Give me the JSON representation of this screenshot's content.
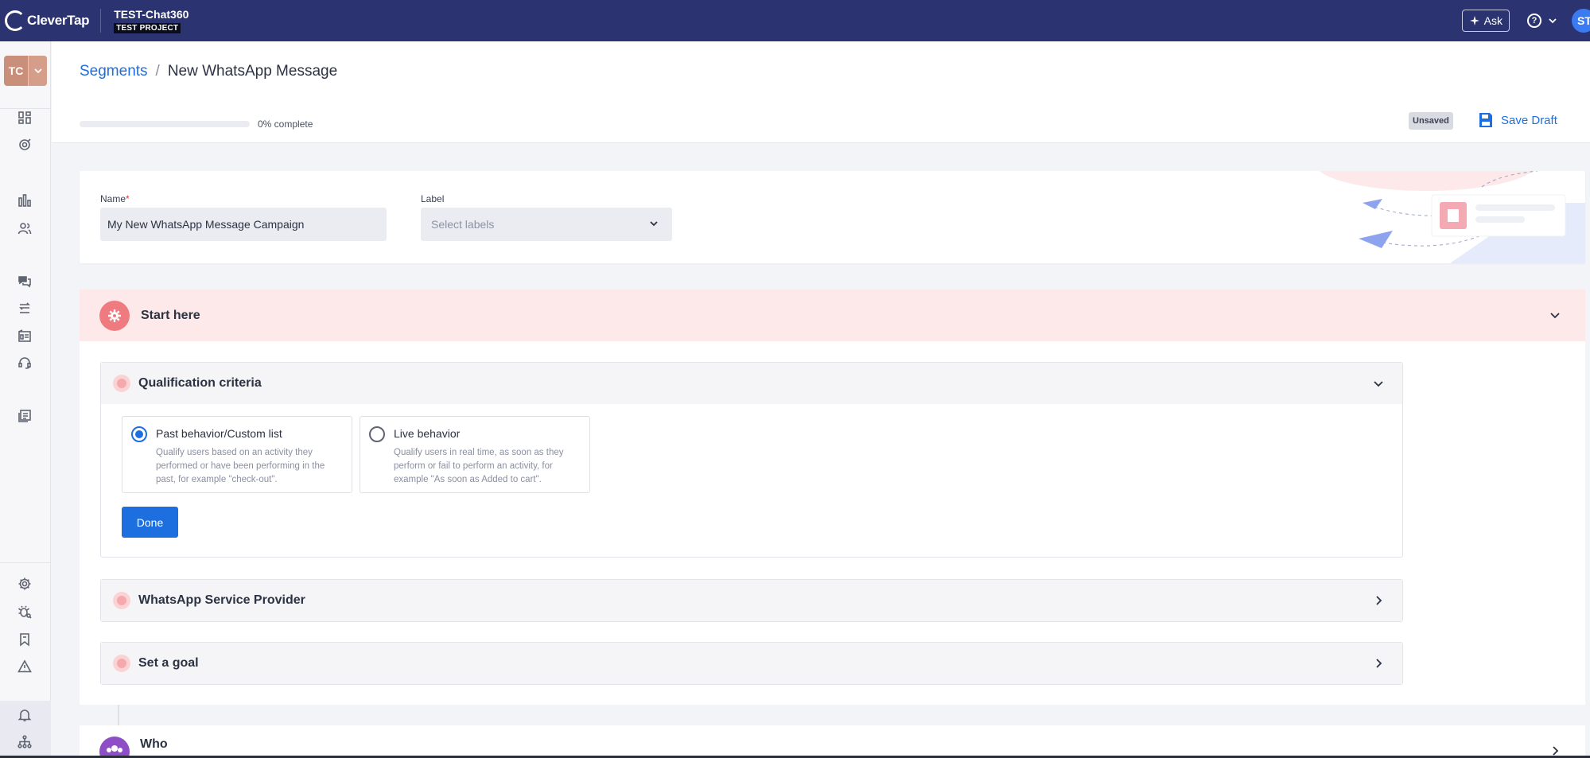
{
  "topbar": {
    "logo_text": "CleverTap",
    "project_name": "TEST-Chat360",
    "project_badge": "TEST PROJECT",
    "ask_label": "Ask",
    "help_glyph": "?",
    "avatar_initials": "ST"
  },
  "sidebar": {
    "workspace_initials": "TC",
    "icons": [
      "dashboard-icon",
      "target-icon",
      "analytics-chart-icon",
      "users-icon",
      "chat-icon",
      "journeys-icon",
      "campaign-board-icon",
      "support-headset-icon",
      "catalog-icon",
      "settings-gear-icon",
      "debug-bug-icon",
      "bookmark-icon",
      "alert-triangle-icon",
      "notification-bell-icon",
      "org-hierarchy-icon"
    ]
  },
  "header": {
    "breadcrumb_link": "Segments",
    "breadcrumb_sep": "/",
    "breadcrumb_current": "New WhatsApp Message",
    "progress_percent": 0,
    "progress_label": "0% complete",
    "status_badge": "Unsaved",
    "save_draft_label": "Save Draft"
  },
  "form": {
    "name_label": "Name",
    "name_required_mark": "*",
    "name_value": "My New WhatsApp Message Campaign",
    "label_label": "Label",
    "label_placeholder": "Select labels"
  },
  "start_section": {
    "title": "Start here",
    "qualification": {
      "title": "Qualification criteria",
      "options": [
        {
          "title": "Past behavior/Custom list",
          "description": "Qualify users based on an activity they performed or have been performing in the past, for example \"check-out\".",
          "selected": true
        },
        {
          "title": "Live behavior",
          "description": "Qualify users in real time, as soon as they perform or fail to perform an activity, for example \"As soon as Added to cart\".",
          "selected": false
        }
      ],
      "done_label": "Done"
    },
    "service_provider_title": "WhatsApp Service Provider",
    "goal_title": "Set a goal"
  },
  "who_section": {
    "title": "Who"
  },
  "colors": {
    "topbar_bg": "#2b3370",
    "accent_blue": "#1d6fe0",
    "start_header_bg": "#fde9ea",
    "start_icon": "#ef7b80",
    "who_icon": "#8e4ec6"
  }
}
